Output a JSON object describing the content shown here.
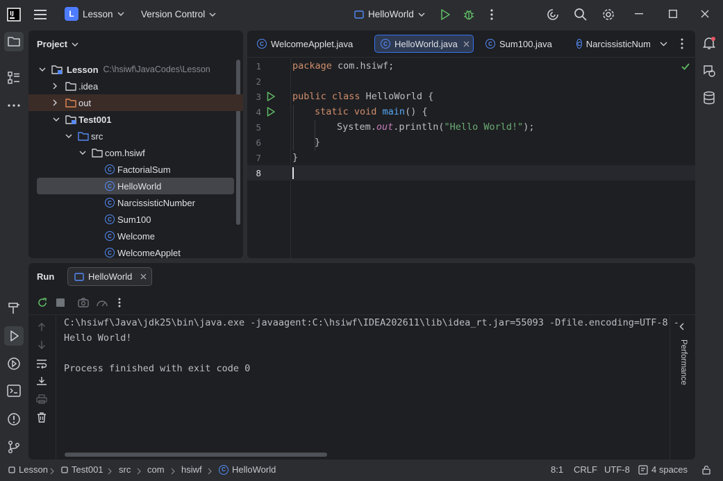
{
  "titlebar": {
    "project_letter": "L",
    "project_name": "Lesson",
    "vcs": "Version Control",
    "run_config": "HelloWorld"
  },
  "project_panel": {
    "title": "Project",
    "tree": [
      {
        "label": "Lesson",
        "path": "C:\\hsiwf\\JavaCodes\\Lesson"
      },
      {
        "label": ".idea"
      },
      {
        "label": "out"
      },
      {
        "label": "Test001"
      },
      {
        "label": "src"
      },
      {
        "label": "com.hsiwf"
      },
      {
        "label": "FactorialSum"
      },
      {
        "label": "HelloWorld"
      },
      {
        "label": "NarcissisticNumber"
      },
      {
        "label": "Sum100"
      },
      {
        "label": "Welcome"
      },
      {
        "label": "WelcomeApplet"
      }
    ]
  },
  "editor": {
    "tabs": [
      "WelcomeApplet.java",
      "HelloWorld.java",
      "Sum100.java",
      "NarcissisticNum"
    ],
    "line_numbers": [
      "1",
      "2",
      "3",
      "4",
      "5",
      "6",
      "7",
      "8"
    ],
    "lines": {
      "l1_kw": "package",
      "l1_rest": " com.hsiwf;",
      "l3_kw": "public class",
      "l3_rest": " HelloWorld {",
      "l4_kw": "static void",
      "l4_fn": "main",
      "l4_rest": "() {",
      "l5_a": "System.",
      "l5_out": "out",
      "l5_b": ".println(",
      "l5_str": "\"Hello World!\"",
      "l5_c": ");",
      "l6": "}",
      "l7": "}"
    }
  },
  "run_panel": {
    "title": "Run",
    "tab": "HelloWorld",
    "console": [
      "C:\\hsiwf\\Java\\jdk25\\bin\\java.exe -javaagent:C:\\hsiwf\\IDEA202611\\lib\\idea_rt.jar=55093 -Dfile.encoding=UTF-8 -",
      "Hello World!",
      "",
      "Process finished with exit code 0"
    ],
    "side_label": "Performance"
  },
  "statusbar": {
    "crumbs": [
      "Lesson",
      "Test001",
      "src",
      "com",
      "hsiwf",
      "HelloWorld"
    ],
    "position": "8:1",
    "line_sep": "CRLF",
    "encoding": "UTF-8",
    "indent": "4 spaces"
  },
  "colors": {
    "accent": "#3574f0",
    "run_green": "#5fb865",
    "keyword": "#cf8e6d",
    "string": "#6aab73"
  }
}
